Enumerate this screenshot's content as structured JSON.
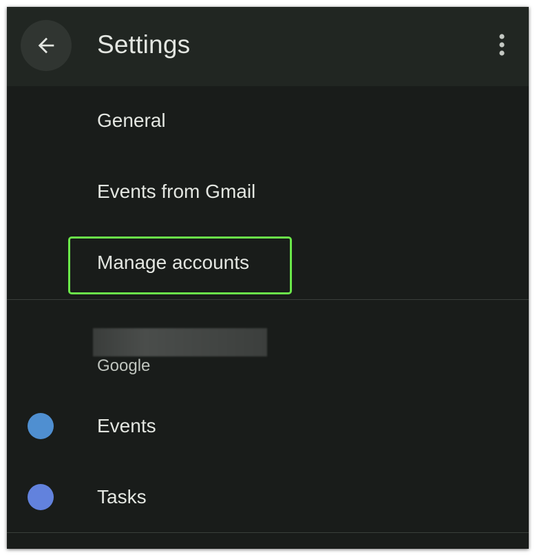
{
  "appbar": {
    "title": "Settings",
    "back_icon": "arrow-back-icon",
    "overflow_icon": "more-vert-icon"
  },
  "menu": {
    "items": [
      {
        "label": "General"
      },
      {
        "label": "Events from Gmail"
      },
      {
        "label": "Manage accounts"
      }
    ],
    "highlight_color": "#6be84a"
  },
  "account": {
    "type_label": "Google",
    "calendars": [
      {
        "label": "Events",
        "color": "#4f8fd1"
      },
      {
        "label": "Tasks",
        "color": "#6282dd"
      }
    ]
  },
  "colors": {
    "background": "#191c1a",
    "appbar": "#212622",
    "text_primary": "#e3e6e1",
    "text_secondary": "#bfc4be"
  }
}
